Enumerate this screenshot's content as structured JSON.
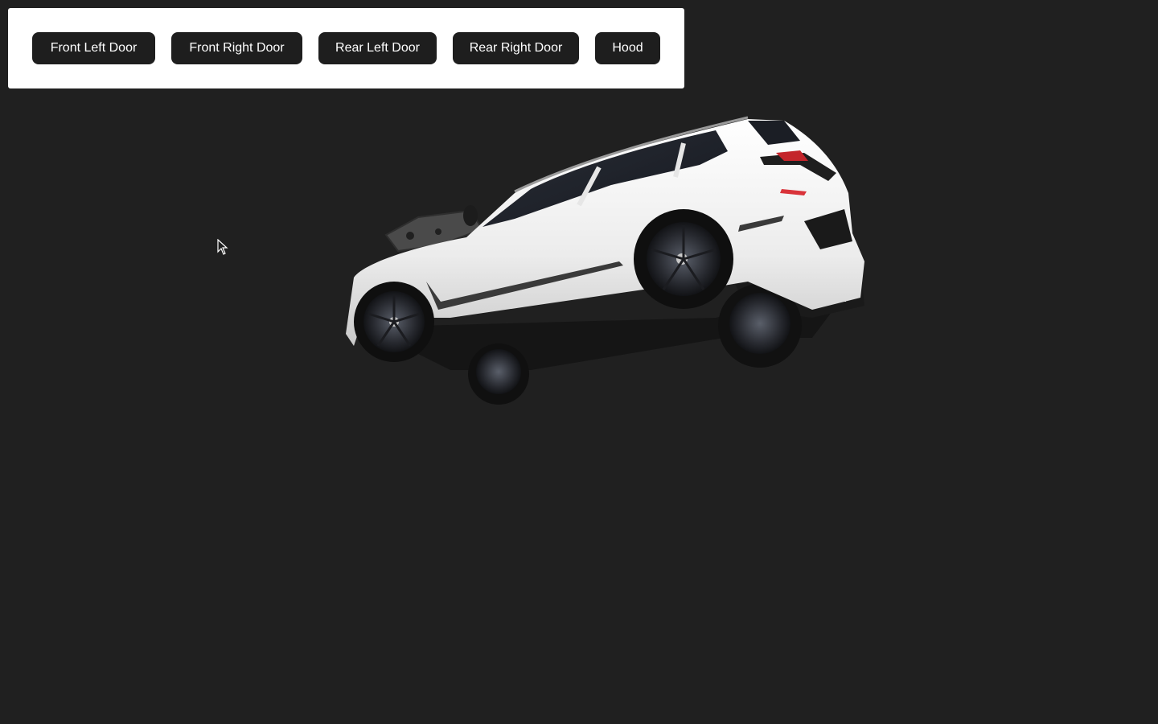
{
  "buttons": [
    {
      "label": "Front Left Door"
    },
    {
      "label": "Front Right Door"
    },
    {
      "label": "Rear Left Door"
    },
    {
      "label": "Rear Right Door"
    },
    {
      "label": "Hood"
    }
  ],
  "scene": {
    "background_color": "#202020",
    "model": "suv-3d-model",
    "body_color": "#f2f2f2"
  },
  "cursor": {
    "icon": "arrow-cursor-icon"
  }
}
